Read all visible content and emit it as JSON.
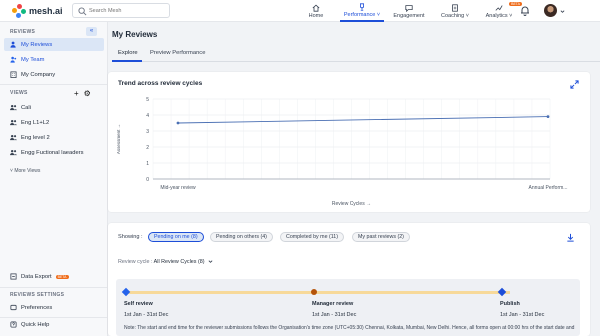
{
  "app": {
    "logo_text": "mesh.ai",
    "brand_color": "#1d4ed8"
  },
  "search": {
    "placeholder": "Search Mesh"
  },
  "nav": [
    {
      "label": "Home",
      "icon": "home-icon"
    },
    {
      "label": "Performance",
      "icon": "trophy-icon",
      "active": true
    },
    {
      "label": "Engagement",
      "icon": "chat-icon"
    },
    {
      "label": "Coaching",
      "icon": "coaching-icon"
    },
    {
      "label": "Analytics",
      "icon": "trend-icon",
      "badge": "BETA"
    }
  ],
  "sidebar": {
    "reviews_title": "REVIEWS",
    "review_items": [
      {
        "label": "My Reviews",
        "icon": "user-check-icon",
        "selected": true
      },
      {
        "label": "My Team",
        "icon": "team-icon"
      },
      {
        "label": "My Company",
        "icon": "building-icon"
      }
    ],
    "views_title": "VIEWS",
    "view_items": [
      {
        "label": "Cali",
        "icon": "group-icon"
      },
      {
        "label": "Eng L1+L2",
        "icon": "group-icon"
      },
      {
        "label": "Eng level 2",
        "icon": "group-icon"
      },
      {
        "label": "Engg Fuctional laeaders",
        "icon": "group-icon"
      }
    ],
    "more_views": "More Views",
    "data_export": "Data Export",
    "data_export_badge": "BETA",
    "settings_title": "REVIEWS SETTINGS",
    "preferences": "Preferences",
    "quick_help": "Quick Help"
  },
  "main": {
    "title": "My Reviews",
    "tabs": [
      {
        "label": "Explore",
        "active": true
      },
      {
        "label": "Preview Performance"
      }
    ]
  },
  "chart_data": {
    "type": "line",
    "title": "Trend across review cycles",
    "xlabel": "Review Cycles →",
    "ylabel": "Assessment →",
    "categories": [
      "Mid-year review",
      "Annual Perform..."
    ],
    "series": [
      {
        "values": [
          3.5,
          3.9
        ]
      }
    ],
    "ylim": [
      0,
      5
    ],
    "yticks": [
      "0",
      "1",
      "2",
      "3",
      "4",
      "5"
    ],
    "grid": true,
    "line_color": "#4a6fb3"
  },
  "pending": {
    "showing_label": "Showing :",
    "filters": [
      {
        "label": "Pending on me (8)",
        "active": true
      },
      {
        "label": "Pending on others (4)"
      },
      {
        "label": "Completed by me (11)"
      },
      {
        "label": "My past reviews (2)"
      }
    ],
    "review_cycle_label": "Review cycle :",
    "review_cycle_value": "All Review Cycles (8)",
    "timeline": [
      {
        "name": "Self review",
        "date": "1st Jan - 31st Dec",
        "color": "#2563eb"
      },
      {
        "name": "Manager review",
        "date": "1st Jan - 31st Dec",
        "color": "#b45309"
      },
      {
        "name": "Publish",
        "date": "1st Jan - 31st Dec",
        "color": "#1d4ed8"
      }
    ],
    "note": "Note: The start and end time for the reviewer submissions follows the Organisation's time zone (UTC+05:30) Chennai, Kolkata, Mumbai, New Delhi. Hence, all forms open at 00:00 hrs of the start date and all"
  }
}
